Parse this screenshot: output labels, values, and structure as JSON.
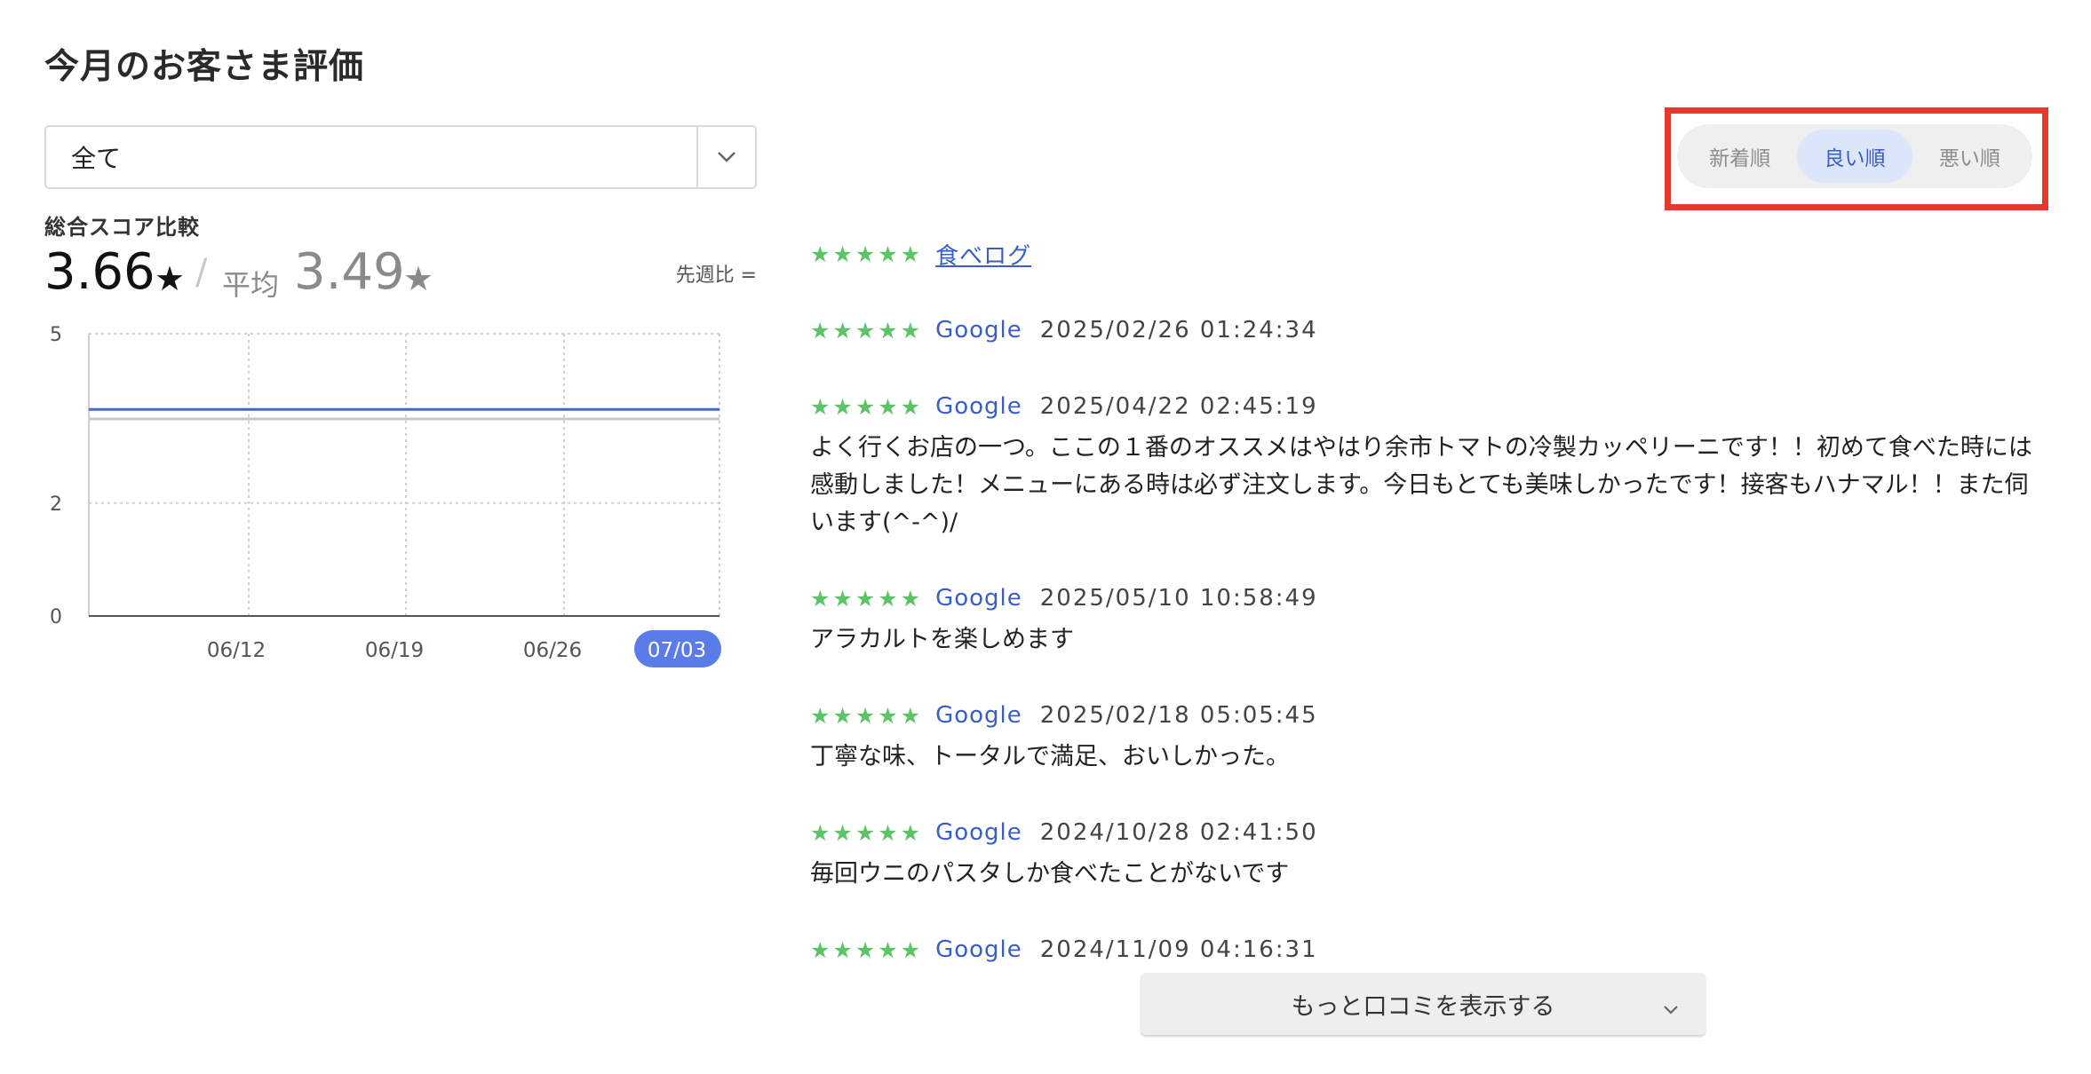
{
  "title": "今月のお客さま評価",
  "filter": {
    "selected": "全て"
  },
  "score": {
    "heading": "総合スコア比較",
    "value": "3.66",
    "star": "★",
    "slash": "/",
    "avg_label": "平均",
    "avg_value": "3.49",
    "wow_label": "先週比 ="
  },
  "sort": {
    "options": [
      "新着順",
      "良い順",
      "悪い順"
    ],
    "active": "良い順"
  },
  "reviews": [
    {
      "stars": "★★★★★",
      "source": "食べログ",
      "date": "",
      "text": ""
    },
    {
      "stars": "★★★★★",
      "source": "Google",
      "date": "2025/02/26 01:24:34",
      "text": ""
    },
    {
      "stars": "★★★★★",
      "source": "Google",
      "date": "2025/04/22 02:45:19",
      "text": "よく行くお店の一つ。ここの１番のオススメはやはり余市トマトの冷製カッペリーニです！！初めて食べた時には感動しました！メニューにある時は必ず注文します。今日もとても美味しかったです！接客もハナマル！！また伺います(^-^)/"
    },
    {
      "stars": "★★★★★",
      "source": "Google",
      "date": "2025/05/10 10:58:49",
      "text": "アラカルトを楽しめます"
    },
    {
      "stars": "★★★★★",
      "source": "Google",
      "date": "2025/02/18 05:05:45",
      "text": "丁寧な味、トータルで満足、おいしかった。"
    },
    {
      "stars": "★★★★★",
      "source": "Google",
      "date": "2024/10/28 02:41:50",
      "text": "毎回ウニのパスタしか食べたことがないです"
    },
    {
      "stars": "★★★★★",
      "source": "Google",
      "date": "2024/11/09 04:16:31",
      "text": ""
    }
  ],
  "more_button": "もっと口コミを表示する",
  "colors": {
    "accent": "#5b7be8",
    "star_green": "#5cc466",
    "link_blue": "#3a5ec9",
    "highlight_red": "#e23b2b",
    "avg_line": "#c8c8c8"
  },
  "chart_data": {
    "type": "line",
    "x": [
      "06/12",
      "06/19",
      "06/26",
      "07/03"
    ],
    "highlighted_x": "07/03",
    "yticks": [
      0,
      2,
      5
    ],
    "ylim": [
      0,
      5
    ],
    "grid": true,
    "series": [
      {
        "values": [
          3.66,
          3.66,
          3.66,
          3.66,
          3.66
        ],
        "color": "#4a66d6"
      },
      {
        "values": [
          3.49,
          3.49,
          3.49,
          3.49,
          3.49
        ],
        "color": "#c8c8c8"
      }
    ]
  }
}
